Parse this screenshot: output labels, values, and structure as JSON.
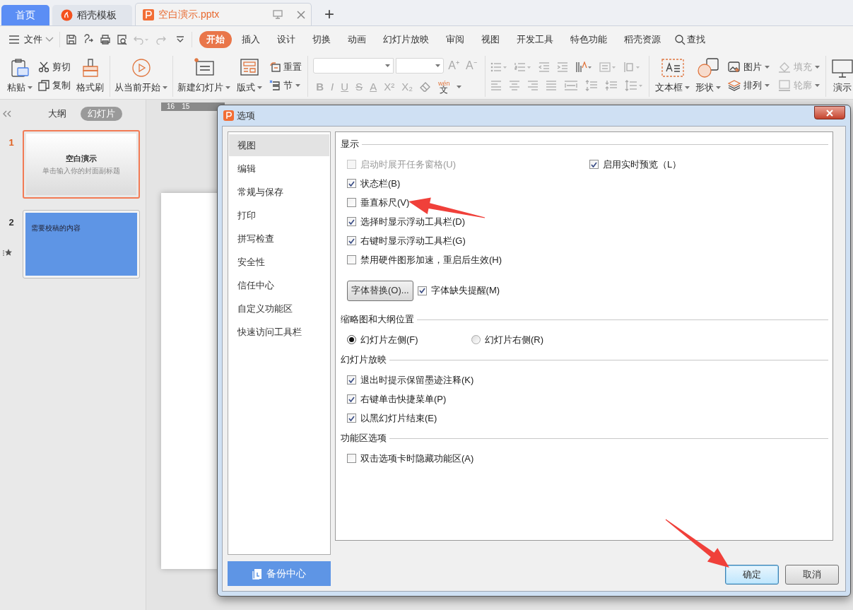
{
  "tabs": [
    {
      "label": "首页",
      "kind": "home",
      "selected": false
    },
    {
      "label": "稻壳模板",
      "kind": "docer",
      "selected": false
    },
    {
      "label": "空白演示.pptx",
      "kind": "doc",
      "selected": true
    }
  ],
  "new_tab": "+",
  "menu": {
    "file": "文件",
    "search": "查找",
    "tabs": [
      {
        "label": "开始",
        "selected": true
      },
      {
        "label": "插入",
        "selected": false
      },
      {
        "label": "设计",
        "selected": false
      },
      {
        "label": "切换",
        "selected": false
      },
      {
        "label": "动画",
        "selected": false
      },
      {
        "label": "幻灯片放映",
        "selected": false
      },
      {
        "label": "审阅",
        "selected": false
      },
      {
        "label": "视图",
        "selected": false
      },
      {
        "label": "开发工具",
        "selected": false
      },
      {
        "label": "特色功能",
        "selected": false
      },
      {
        "label": "稻壳资源",
        "selected": false
      }
    ]
  },
  "ribbon": {
    "paste": "粘贴",
    "cut": "剪切",
    "copy": "复制",
    "format_painter": "格式刷",
    "play_from_current": "从当前开始",
    "new_slide": "新建幻灯片",
    "layout": "版式",
    "reset": "重置",
    "section": "节",
    "font_size_glyphs": [
      "A⁺",
      "A⁻"
    ],
    "format_glyphs": [
      "B",
      "I",
      "U",
      "S",
      "A",
      "X²",
      "X₂"
    ],
    "phonetic": {
      "pinyin": "wén",
      "char": "文"
    },
    "text_box": "文本框",
    "shape": "形状",
    "object_tools": [
      {
        "label": "图片",
        "disabled": false
      },
      {
        "label": "填充",
        "disabled": true
      },
      {
        "label": "排列",
        "disabled": false
      },
      {
        "label": "轮廓",
        "disabled": true
      }
    ],
    "present_tool": "演示"
  },
  "side_panel": {
    "view_tabs": [
      {
        "label": "大纲",
        "selected": false
      },
      {
        "label": "幻灯片",
        "selected": true
      }
    ],
    "slides": [
      {
        "number": "1",
        "kind": "title",
        "selected": true,
        "starred": false,
        "title": "空白演示",
        "subtitle": "单击输入你的封面副标题"
      },
      {
        "number": "2",
        "kind": "content",
        "selected": false,
        "starred": true,
        "title": "需要校稿的内容"
      }
    ]
  },
  "ruler": [
    "16",
    "15"
  ],
  "dialog": {
    "title": "选项",
    "nav": [
      {
        "label": "视图",
        "selected": true
      },
      {
        "label": "编辑",
        "selected": false
      },
      {
        "label": "常规与保存",
        "selected": false
      },
      {
        "label": "打印",
        "selected": false
      },
      {
        "label": "拼写检查",
        "selected": false
      },
      {
        "label": "安全性",
        "selected": false
      },
      {
        "label": "信任中心",
        "selected": false
      },
      {
        "label": "自定义功能区",
        "selected": false
      },
      {
        "label": "快速访问工具栏",
        "selected": false
      }
    ],
    "backup": "备份中心",
    "sections": [
      {
        "title": "显示",
        "rows": [
          {
            "kind": "wide",
            "controls": [
              {
                "kind": "checkbox",
                "label": "启动时展开任务窗格(U)",
                "checked": false,
                "disabled": true
              },
              {
                "kind": "checkbox",
                "label": "启用实时预览（L）",
                "checked": true,
                "disabled": false
              }
            ]
          },
          {
            "kind": "single",
            "controls": [
              {
                "kind": "checkbox",
                "label": "状态栏(B)",
                "checked": true,
                "disabled": false
              }
            ]
          },
          {
            "kind": "single",
            "controls": [
              {
                "kind": "checkbox",
                "label": "垂直标尺(V)",
                "checked": false,
                "disabled": false
              }
            ]
          },
          {
            "kind": "single",
            "controls": [
              {
                "kind": "checkbox",
                "label": "选择时显示浮动工具栏(D)",
                "checked": true,
                "disabled": false
              }
            ]
          },
          {
            "kind": "single",
            "controls": [
              {
                "kind": "checkbox",
                "label": "右键时显示浮动工具栏(G)",
                "checked": true,
                "disabled": false
              }
            ]
          },
          {
            "kind": "single",
            "controls": [
              {
                "kind": "checkbox",
                "label": "禁用硬件图形加速，重启后生效(H)",
                "checked": false,
                "disabled": false
              }
            ]
          },
          {
            "kind": "inline",
            "controls": [
              {
                "kind": "button",
                "label": "字体替换(O)..."
              },
              {
                "kind": "checkbox",
                "label": "字体缺失提醒(M)",
                "checked": true,
                "disabled": false
              }
            ]
          }
        ]
      },
      {
        "title": "缩略图和大纲位置",
        "rows": [
          {
            "kind": "split",
            "controls": [
              {
                "kind": "radio",
                "label": "幻灯片左侧(F)",
                "selected": true
              },
              {
                "kind": "radio",
                "label": "幻灯片右侧(R)",
                "selected": false
              }
            ]
          }
        ]
      },
      {
        "title": "幻灯片放映",
        "rows": [
          {
            "kind": "single",
            "controls": [
              {
                "kind": "checkbox",
                "label": "退出时提示保留墨迹注释(K)",
                "checked": true,
                "disabled": false
              }
            ]
          },
          {
            "kind": "single",
            "controls": [
              {
                "kind": "checkbox",
                "label": "右键单击快捷菜单(P)",
                "checked": true,
                "disabled": false
              }
            ]
          },
          {
            "kind": "single",
            "controls": [
              {
                "kind": "checkbox",
                "label": "以黑幻灯片结束(E)",
                "checked": true,
                "disabled": false
              }
            ]
          }
        ]
      },
      {
        "title": "功能区选项",
        "rows": [
          {
            "kind": "single",
            "controls": [
              {
                "kind": "checkbox",
                "label": "双击选项卡时隐藏功能区(A)",
                "checked": false,
                "disabled": false
              }
            ]
          }
        ]
      }
    ],
    "ok": "确定",
    "cancel": "取消"
  }
}
